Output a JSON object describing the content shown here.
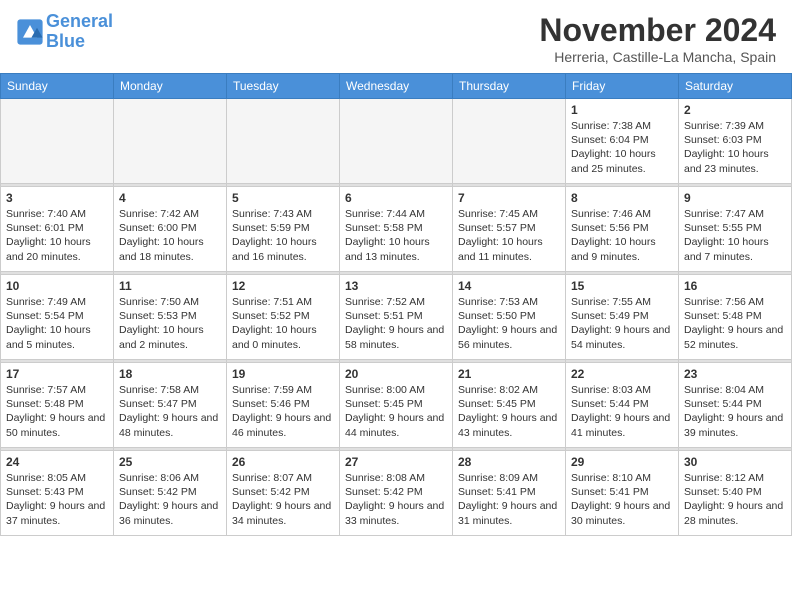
{
  "header": {
    "logo_line1": "General",
    "logo_line2": "Blue",
    "month": "November 2024",
    "location": "Herreria, Castille-La Mancha, Spain"
  },
  "weekdays": [
    "Sunday",
    "Monday",
    "Tuesday",
    "Wednesday",
    "Thursday",
    "Friday",
    "Saturday"
  ],
  "weeks": [
    [
      {
        "day": "",
        "info": ""
      },
      {
        "day": "",
        "info": ""
      },
      {
        "day": "",
        "info": ""
      },
      {
        "day": "",
        "info": ""
      },
      {
        "day": "",
        "info": ""
      },
      {
        "day": "1",
        "info": "Sunrise: 7:38 AM\nSunset: 6:04 PM\nDaylight: 10 hours and 25 minutes."
      },
      {
        "day": "2",
        "info": "Sunrise: 7:39 AM\nSunset: 6:03 PM\nDaylight: 10 hours and 23 minutes."
      }
    ],
    [
      {
        "day": "3",
        "info": "Sunrise: 7:40 AM\nSunset: 6:01 PM\nDaylight: 10 hours and 20 minutes."
      },
      {
        "day": "4",
        "info": "Sunrise: 7:42 AM\nSunset: 6:00 PM\nDaylight: 10 hours and 18 minutes."
      },
      {
        "day": "5",
        "info": "Sunrise: 7:43 AM\nSunset: 5:59 PM\nDaylight: 10 hours and 16 minutes."
      },
      {
        "day": "6",
        "info": "Sunrise: 7:44 AM\nSunset: 5:58 PM\nDaylight: 10 hours and 13 minutes."
      },
      {
        "day": "7",
        "info": "Sunrise: 7:45 AM\nSunset: 5:57 PM\nDaylight: 10 hours and 11 minutes."
      },
      {
        "day": "8",
        "info": "Sunrise: 7:46 AM\nSunset: 5:56 PM\nDaylight: 10 hours and 9 minutes."
      },
      {
        "day": "9",
        "info": "Sunrise: 7:47 AM\nSunset: 5:55 PM\nDaylight: 10 hours and 7 minutes."
      }
    ],
    [
      {
        "day": "10",
        "info": "Sunrise: 7:49 AM\nSunset: 5:54 PM\nDaylight: 10 hours and 5 minutes."
      },
      {
        "day": "11",
        "info": "Sunrise: 7:50 AM\nSunset: 5:53 PM\nDaylight: 10 hours and 2 minutes."
      },
      {
        "day": "12",
        "info": "Sunrise: 7:51 AM\nSunset: 5:52 PM\nDaylight: 10 hours and 0 minutes."
      },
      {
        "day": "13",
        "info": "Sunrise: 7:52 AM\nSunset: 5:51 PM\nDaylight: 9 hours and 58 minutes."
      },
      {
        "day": "14",
        "info": "Sunrise: 7:53 AM\nSunset: 5:50 PM\nDaylight: 9 hours and 56 minutes."
      },
      {
        "day": "15",
        "info": "Sunrise: 7:55 AM\nSunset: 5:49 PM\nDaylight: 9 hours and 54 minutes."
      },
      {
        "day": "16",
        "info": "Sunrise: 7:56 AM\nSunset: 5:48 PM\nDaylight: 9 hours and 52 minutes."
      }
    ],
    [
      {
        "day": "17",
        "info": "Sunrise: 7:57 AM\nSunset: 5:48 PM\nDaylight: 9 hours and 50 minutes."
      },
      {
        "day": "18",
        "info": "Sunrise: 7:58 AM\nSunset: 5:47 PM\nDaylight: 9 hours and 48 minutes."
      },
      {
        "day": "19",
        "info": "Sunrise: 7:59 AM\nSunset: 5:46 PM\nDaylight: 9 hours and 46 minutes."
      },
      {
        "day": "20",
        "info": "Sunrise: 8:00 AM\nSunset: 5:45 PM\nDaylight: 9 hours and 44 minutes."
      },
      {
        "day": "21",
        "info": "Sunrise: 8:02 AM\nSunset: 5:45 PM\nDaylight: 9 hours and 43 minutes."
      },
      {
        "day": "22",
        "info": "Sunrise: 8:03 AM\nSunset: 5:44 PM\nDaylight: 9 hours and 41 minutes."
      },
      {
        "day": "23",
        "info": "Sunrise: 8:04 AM\nSunset: 5:44 PM\nDaylight: 9 hours and 39 minutes."
      }
    ],
    [
      {
        "day": "24",
        "info": "Sunrise: 8:05 AM\nSunset: 5:43 PM\nDaylight: 9 hours and 37 minutes."
      },
      {
        "day": "25",
        "info": "Sunrise: 8:06 AM\nSunset: 5:42 PM\nDaylight: 9 hours and 36 minutes."
      },
      {
        "day": "26",
        "info": "Sunrise: 8:07 AM\nSunset: 5:42 PM\nDaylight: 9 hours and 34 minutes."
      },
      {
        "day": "27",
        "info": "Sunrise: 8:08 AM\nSunset: 5:42 PM\nDaylight: 9 hours and 33 minutes."
      },
      {
        "day": "28",
        "info": "Sunrise: 8:09 AM\nSunset: 5:41 PM\nDaylight: 9 hours and 31 minutes."
      },
      {
        "day": "29",
        "info": "Sunrise: 8:10 AM\nSunset: 5:41 PM\nDaylight: 9 hours and 30 minutes."
      },
      {
        "day": "30",
        "info": "Sunrise: 8:12 AM\nSunset: 5:40 PM\nDaylight: 9 hours and 28 minutes."
      }
    ]
  ]
}
